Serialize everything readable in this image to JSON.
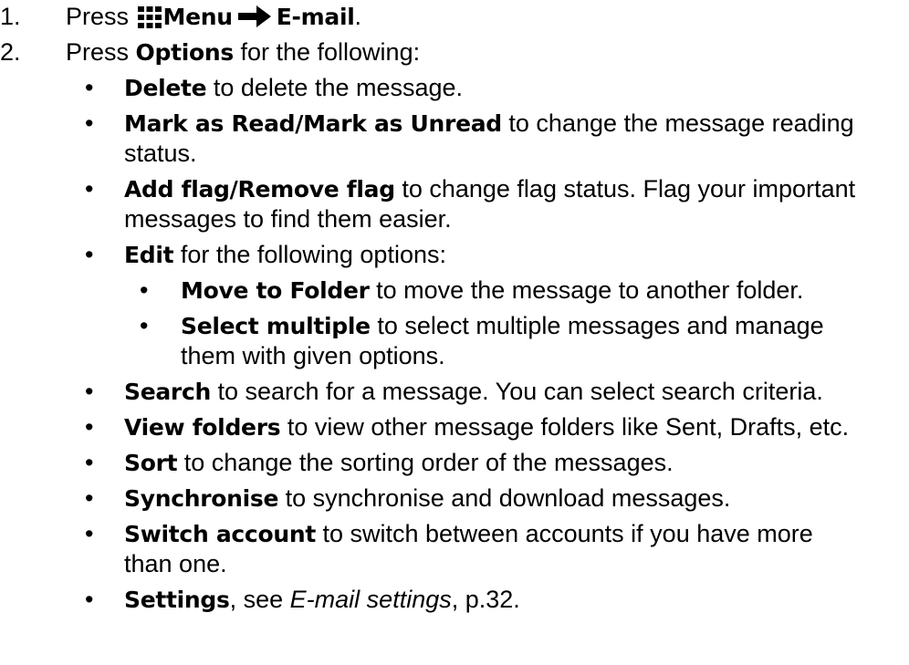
{
  "steps": [
    {
      "number": "1.",
      "press": "Press",
      "menu": "Menu",
      "email": "E-mail",
      "period": "."
    },
    {
      "number": "2.",
      "press": "Press",
      "options": "Options",
      "rest": "for the following:"
    }
  ],
  "options": [
    {
      "kw": "Delete",
      "text": "to delete the message."
    },
    {
      "kw": "Mark as Read",
      "sep": "/",
      "kw2": "Mark as Unread",
      "text": "to change the message reading",
      "text2": "status."
    },
    {
      "kw": "Add flag",
      "sep": "/",
      "kw2": "Remove flag",
      "text": "to change flag status. Flag your important",
      "text2": "messages to find them easier."
    },
    {
      "kw": "Edit",
      "text": "for the following options:"
    },
    {
      "kw": "Search",
      "text": "to search for a message. You can select search criteria."
    },
    {
      "kw": "View folders",
      "text": "to view other message folders like Sent, Drafts, etc."
    },
    {
      "kw": "Sort",
      "text": "to change the sorting order of the messages."
    },
    {
      "kw": "Synchronise",
      "text": "to synchronise and download messages."
    },
    {
      "kw": "Switch account",
      "text": "to switch between accounts if you have more",
      "text2": "than one."
    },
    {
      "kw": "Settings",
      "text": ", see",
      "ref": "E-mail settings",
      "page": ", p.32."
    }
  ],
  "edit_options": [
    {
      "kw": "Move to Folder",
      "text": "to move the message to another folder."
    },
    {
      "kw": "Select multiple",
      "text": "to select multiple messages and manage",
      "text2": "them with given options."
    }
  ],
  "bullet": "•",
  "icons": {
    "menu": "grid-menu-icon",
    "arrow": "right-arrow-icon"
  }
}
